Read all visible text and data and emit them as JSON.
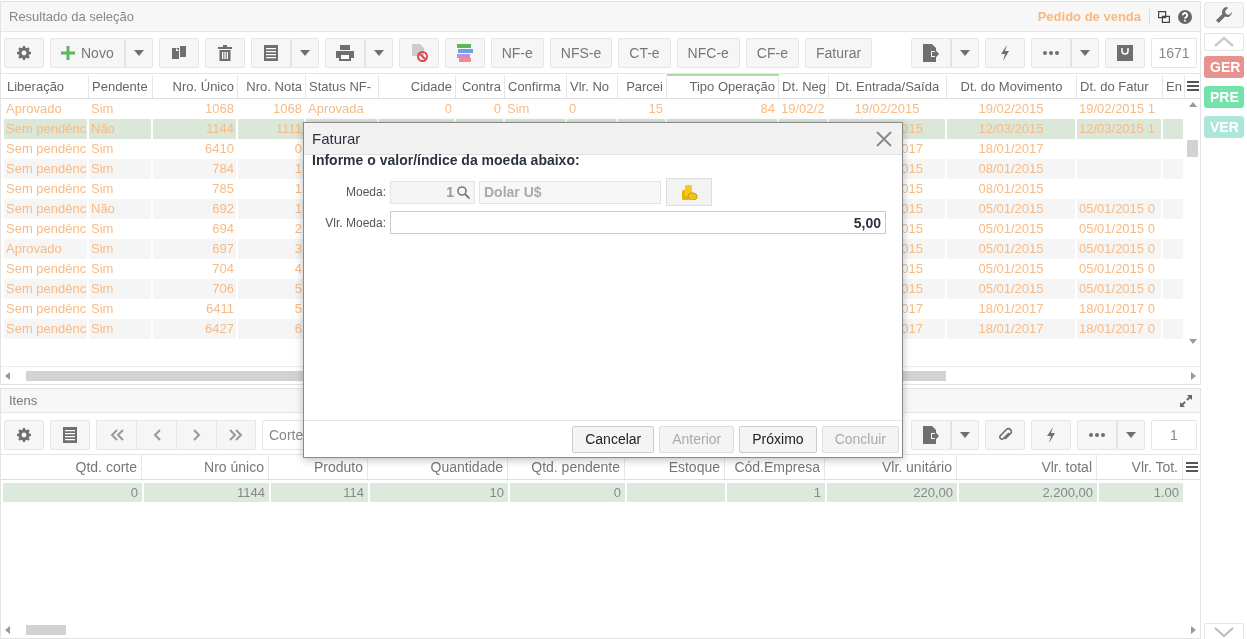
{
  "top_panel": {
    "title": "Resultado da seleção",
    "context": "Pedido de venda",
    "toolbar": {
      "new_label": "Novo",
      "text_buttons": [
        "NF-e",
        "NFS-e",
        "CT-e",
        "NFC-e",
        "CF-e",
        "Faturar"
      ],
      "record_count": "1671"
    },
    "table": {
      "columns": [
        {
          "label": "Liberação",
          "sorted": false
        },
        {
          "label": "Pendente",
          "sorted": false
        },
        {
          "label": "Nro. Único",
          "sorted": false
        },
        {
          "label": "Nro. Nota",
          "sorted": false
        },
        {
          "label": "Status NF-",
          "sorted": false
        },
        {
          "label": "Cidade",
          "sorted": false
        },
        {
          "label": "Contra",
          "sorted": false
        },
        {
          "label": "Confirma",
          "sorted": false
        },
        {
          "label": "Vlr. No",
          "sorted": false
        },
        {
          "label": "Parcei",
          "sorted": false
        },
        {
          "label": "Tipo Operação",
          "sorted": true
        },
        {
          "label": "Dt. Neg",
          "sorted": false
        },
        {
          "label": "Dt. Entrada/Saída",
          "sorted": false
        },
        {
          "label": "Dt. do Movimento",
          "sorted": false
        },
        {
          "label": "Dt. do Fatur",
          "sorted": false
        },
        {
          "label": "En",
          "sorted": false
        }
      ],
      "rows": [
        {
          "selected": false,
          "cells": [
            "Aprovado",
            "Sim",
            "1068",
            "1068",
            "Aprovada",
            "0",
            "0",
            "Sim",
            "0",
            "15",
            "84",
            "19/02/2",
            "19/02/2015",
            "19/02/2015",
            "19/02/2015 1"
          ]
        },
        {
          "selected": true,
          "before": [
            "Sem pendênc",
            "Não",
            "1144",
            "1111"
          ],
          "after": [
            "015",
            "12/03/2015",
            "12/03/2015 1"
          ]
        },
        {
          "selected": false,
          "before": [
            "Sem pendênc",
            "Sim",
            "6410",
            "0"
          ],
          "after": [
            "017",
            "18/01/2017"
          ]
        },
        {
          "selected": false,
          "before": [
            "Sem pendênc",
            "Sim",
            "784",
            "1"
          ],
          "after": [
            "015",
            "08/01/2015"
          ]
        },
        {
          "selected": false,
          "before": [
            "Sem pendênc",
            "Sim",
            "785",
            "1"
          ],
          "after": [
            "015",
            "08/01/2015"
          ]
        },
        {
          "selected": false,
          "before": [
            "Sem pendênc",
            "Não",
            "692",
            "1"
          ],
          "after": [
            "015",
            "05/01/2015",
            "05/01/2015 0"
          ]
        },
        {
          "selected": false,
          "before": [
            "Sem pendênc",
            "Sim",
            "694",
            "2"
          ],
          "after": [
            "015",
            "05/01/2015",
            "05/01/2015 0"
          ]
        },
        {
          "selected": false,
          "before": [
            "Aprovado",
            "Sim",
            "697",
            "3"
          ],
          "after": [
            "015",
            "05/01/2015",
            "05/01/2015 0"
          ]
        },
        {
          "selected": false,
          "before": [
            "Sem pendênc",
            "Sim",
            "704",
            "4"
          ],
          "after": [
            "015",
            "05/01/2015",
            "05/01/2015 0"
          ]
        },
        {
          "selected": false,
          "before": [
            "Sem pendênc",
            "Sim",
            "706",
            "5"
          ],
          "after": [
            "015",
            "05/01/2015",
            "05/01/2015 0"
          ]
        },
        {
          "selected": false,
          "before": [
            "Sem pendênc",
            "Sim",
            "6411",
            "5"
          ],
          "after": [
            "017",
            "18/01/2017",
            "18/01/2017 0"
          ]
        },
        {
          "selected": false,
          "before": [
            "Sem pendênc",
            "Sim",
            "6427",
            "6"
          ],
          "after": [
            "017",
            "18/01/2017",
            "18/01/2017 0"
          ]
        }
      ]
    }
  },
  "items_panel": {
    "title": "Itens",
    "toolbar": {
      "view_field": "Corte",
      "record_count": "1"
    },
    "table": {
      "columns": [
        "Qtd. corte",
        "Nro único",
        "Produto",
        "Quantidade",
        "Qtd. pendente",
        "Estoque",
        "Cód.Empresa",
        "Vlr. unitário",
        "Vlr. total",
        "Vlr. Tot."
      ],
      "rows": [
        {
          "selected": true,
          "cells": [
            "0",
            "1144",
            "114",
            "10",
            "0",
            null,
            "1",
            "220,00",
            "2.200,00",
            "1.00"
          ]
        }
      ]
    }
  },
  "side_rail": {
    "tags": [
      {
        "label": "GER",
        "color": "#e8928f"
      },
      {
        "label": "PRE",
        "color": "#74e3ab"
      },
      {
        "label": "VER",
        "color": "#ade7dc"
      }
    ]
  },
  "dialog": {
    "title": "Faturar",
    "prompt": "Informe o valor/índice da moeda abaixo:",
    "fields": [
      {
        "kind": "lookup",
        "label": "Moeda:",
        "code": "1",
        "description": "Dolar U$"
      },
      {
        "kind": "number",
        "label": "Vlr. Moeda:",
        "value": "5,00"
      }
    ],
    "buttons": [
      {
        "label": "Cancelar",
        "disabled": false
      },
      {
        "label": "Anterior",
        "disabled": true
      },
      {
        "label": "Próximo",
        "disabled": false
      },
      {
        "label": "Concluir",
        "disabled": true
      }
    ]
  }
}
